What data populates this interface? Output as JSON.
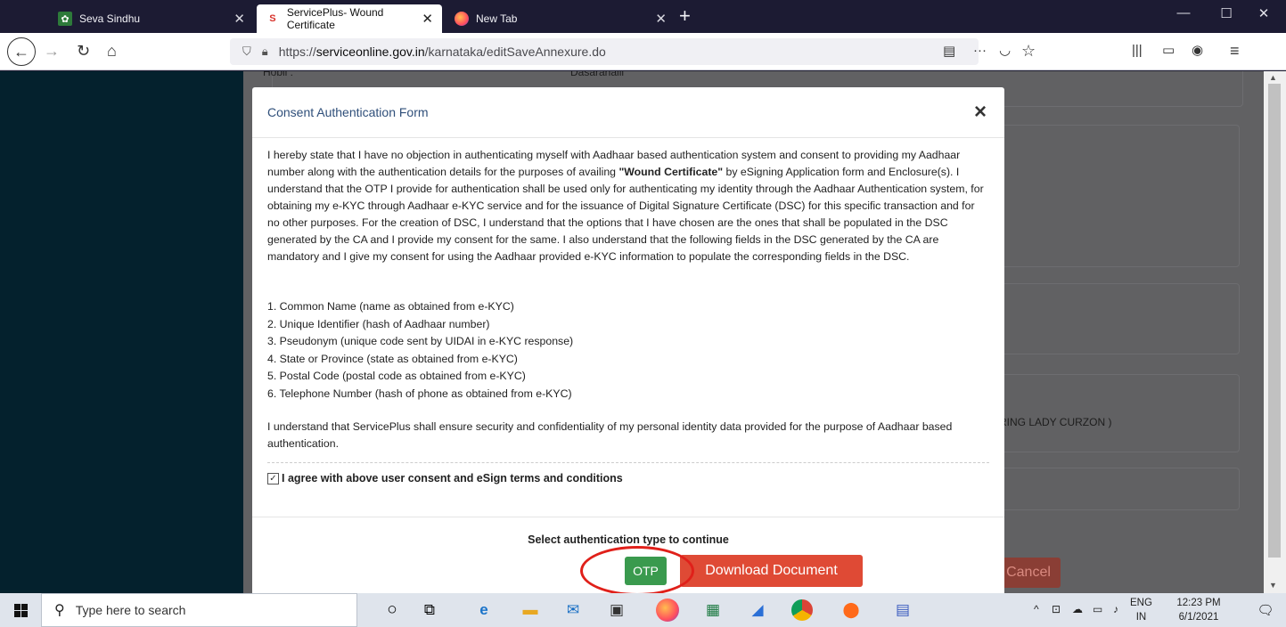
{
  "browser": {
    "tabs": [
      {
        "title": "Seva Sindhu",
        "active": false
      },
      {
        "title": "ServicePlus- Wound Certificate",
        "active": true
      },
      {
        "title": "New Tab",
        "active": false
      }
    ],
    "url_prefix": "https://",
    "url_domain": "serviceonline.gov.in",
    "url_path": "/karnataka/editSaveAnnexure.do"
  },
  "background_page": {
    "hobli_label": "Hobli :",
    "hobli_value": "Dasarahalli",
    "hospital_fragment": "RING LADY CURZON )",
    "cancel_label": "Cancel"
  },
  "modal": {
    "title": "Consent Authentication Form",
    "close_glyph": "×",
    "consent_before_bold": "I hereby state that I have no objection in authenticating myself with Aadhaar based authentication system and consent to providing my Aadhaar number along with the authentication details for the purposes of availing ",
    "consent_bold": "\"Wound Certificate\"",
    "consent_after_bold": " by eSigning Application form and Enclosure(s). I understand that the OTP I provide for authentication shall be used only for authenticating my identity through the Aadhaar Authentication system, for obtaining my e-KYC through Aadhaar e-KYC service and for the issuance of Digital Signature Certificate (DSC) for this specific transaction and for no other purposes. For the creation of DSC, I understand that the options that I have chosen are the ones that shall be populated in the DSC generated by the CA and I provide my consent for the same. I also understand that the following fields in the DSC generated by the CA are mandatory and I give my consent for using the Aadhaar provided e-KYC information to populate the corresponding fields in the DSC.",
    "fields": [
      "1. Common Name (name as obtained from e-KYC)",
      "2. Unique Identifier (hash of Aadhaar number)",
      "3. Pseudonym (unique code sent by UIDAI in e-KYC response)",
      "4. State or Province (state as obtained from e-KYC)",
      "5. Postal Code (postal code as obtained from e-KYC)",
      "6. Telephone Number (hash of phone as obtained from e-KYC)"
    ],
    "security_text": "I understand that ServicePlus shall ensure security and confidentiality of my personal identity data provided for the purpose of Aadhaar based authentication.",
    "agree_label": "I agree with above user consent and eSign terms and conditions",
    "agree_checked": true,
    "select_auth_label": "Select authentication type to continue",
    "otp_label": "OTP",
    "download_label": "Download Document"
  },
  "taskbar": {
    "search_placeholder": "Type here to search",
    "language": "ENG",
    "region": "IN",
    "time": "12:23 PM",
    "date": "6/1/2021"
  },
  "colors": {
    "otp_button": "#3a9a4e",
    "download_button": "#df4a35",
    "highlight_ring": "#e0201a",
    "modal_title": "#2f4f7a"
  }
}
